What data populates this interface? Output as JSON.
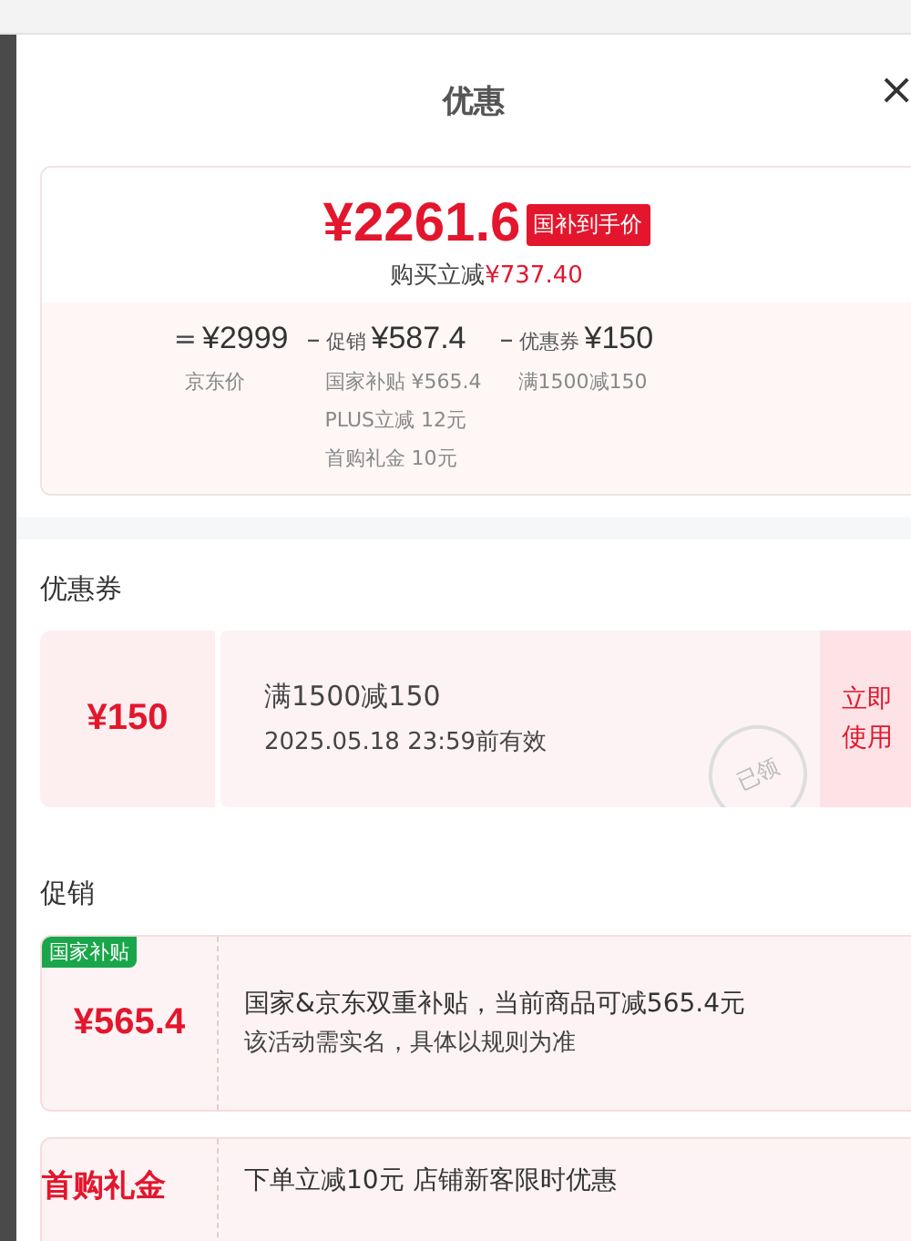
{
  "panel": {
    "title": "优惠",
    "close": "×"
  },
  "price": {
    "final": "¥2261.6",
    "tag": "国补到手价",
    "saving_label": "购买立减",
    "saving": "¥737.40",
    "terms": [
      {
        "op": "=",
        "amount": "¥2999",
        "notes": [
          "京东价"
        ]
      },
      {
        "op": "–",
        "label": "促销",
        "amount": "¥587.4",
        "notes": [
          "国家补贴 ¥565.4",
          "PLUS立减 12元",
          "首购礼金 10元"
        ]
      },
      {
        "op": "–",
        "label": "优惠券",
        "amount": "¥150",
        "notes": [
          "满1500减150"
        ]
      }
    ]
  },
  "coupons": {
    "heading": "优惠券",
    "items": [
      {
        "amount": "¥150",
        "title": "满1500减150",
        "validity": "2025.05.18 23:59前有效",
        "claimed_stamp": "已领",
        "action": "立即使用"
      }
    ]
  },
  "promotions": {
    "heading": "促销",
    "items": [
      {
        "badge": "国家补贴",
        "amount": "¥565.4",
        "lines": [
          "国家&京东双重补贴，当前商品可减565.4元",
          "该活动需实名，具体以规则为准"
        ]
      },
      {
        "amount": "首购礼金",
        "lines": [
          "下单立减10元 店铺新客限时优惠"
        ]
      }
    ]
  }
}
